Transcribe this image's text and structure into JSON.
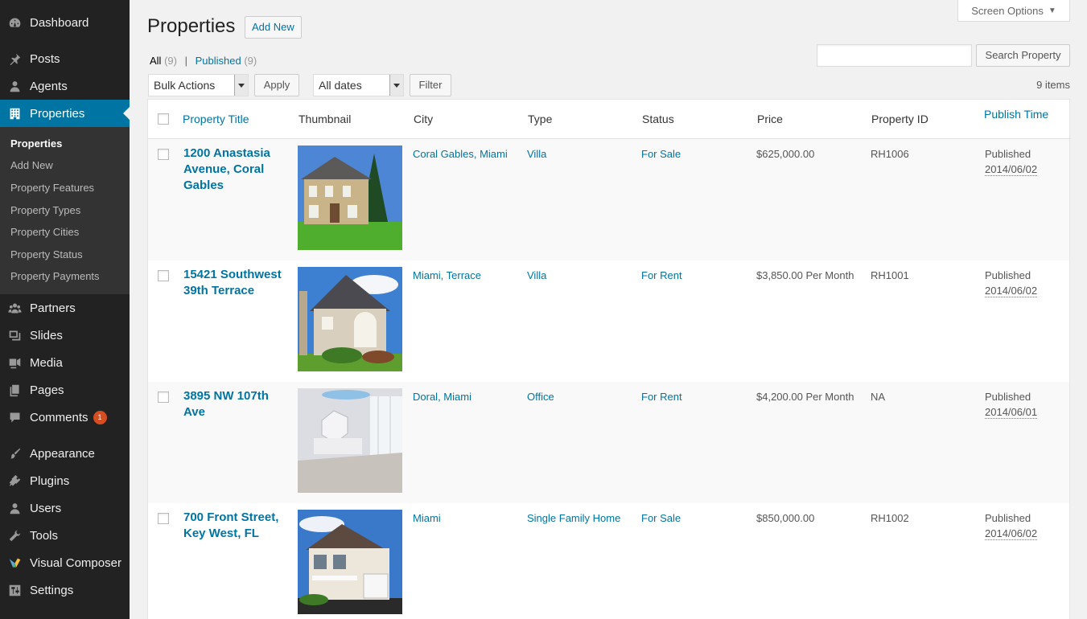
{
  "sidebar": {
    "menu": [
      {
        "label": "Dashboard",
        "icon": "dashboard-icon"
      },
      {
        "label": "Posts",
        "icon": "pin-icon"
      },
      {
        "label": "Agents",
        "icon": "user-icon"
      },
      {
        "label": "Properties",
        "icon": "building-icon"
      },
      {
        "label": "Partners",
        "icon": "group-icon"
      },
      {
        "label": "Slides",
        "icon": "slides-icon"
      },
      {
        "label": "Media",
        "icon": "media-icon"
      },
      {
        "label": "Pages",
        "icon": "pages-icon"
      },
      {
        "label": "Comments",
        "icon": "comment-icon",
        "badge": "1"
      },
      {
        "label": "Appearance",
        "icon": "brush-icon"
      },
      {
        "label": "Plugins",
        "icon": "plugin-icon"
      },
      {
        "label": "Users",
        "icon": "user-icon"
      },
      {
        "label": "Tools",
        "icon": "wrench-icon"
      },
      {
        "label": "Visual Composer",
        "icon": "visual-composer-icon"
      },
      {
        "label": "Settings",
        "icon": "settings-icon"
      }
    ],
    "submenu": [
      "Properties",
      "Add New",
      "Property Features",
      "Property Types",
      "Property Cities",
      "Property Status",
      "Property Payments"
    ]
  },
  "header": {
    "title": "Properties",
    "add_new": "Add New",
    "screen_options": "Screen Options"
  },
  "views": {
    "all": "All",
    "all_count": "(9)",
    "sep": "|",
    "published": "Published",
    "published_count": "(9)"
  },
  "search": {
    "button": "Search Property",
    "value": ""
  },
  "actions": {
    "bulk": "Bulk Actions",
    "apply": "Apply",
    "dates": "All dates",
    "filter": "Filter",
    "items": "9 items"
  },
  "table": {
    "columns": [
      "Property Title",
      "Thumbnail",
      "City",
      "Type",
      "Status",
      "Price",
      "Property ID",
      "Publish Time"
    ],
    "rows": [
      {
        "title": "1200 Anastasia Avenue, Coral Gables",
        "city": "Coral Gables, Miami",
        "type": "Villa",
        "status": "For Sale",
        "price": "$625,000.00",
        "id": "RH1006",
        "published": "Published",
        "date": "2014/06/02"
      },
      {
        "title": "15421 Southwest 39th Terrace",
        "city": "Miami, Terrace",
        "type": "Villa",
        "status": "For Rent",
        "price": "$3,850.00 Per Month",
        "id": "RH1001",
        "published": "Published",
        "date": "2014/06/02"
      },
      {
        "title": "3895 NW 107th Ave",
        "city": "Doral, Miami",
        "type": "Office",
        "status": "For Rent",
        "price": "$4,200.00 Per Month",
        "id": "NA",
        "published": "Published",
        "date": "2014/06/01"
      },
      {
        "title": "700 Front Street, Key West, FL",
        "city": "Miami",
        "type": "Single Family Home",
        "status": "For Sale",
        "price": "$850,000.00",
        "id": "RH1002",
        "published": "Published",
        "date": "2014/06/02"
      }
    ]
  },
  "colors": {
    "sidebar": "#222222",
    "submenu": "#333333",
    "active": "#0074a2",
    "link": "#0074a2",
    "badge": "#d54e21"
  }
}
